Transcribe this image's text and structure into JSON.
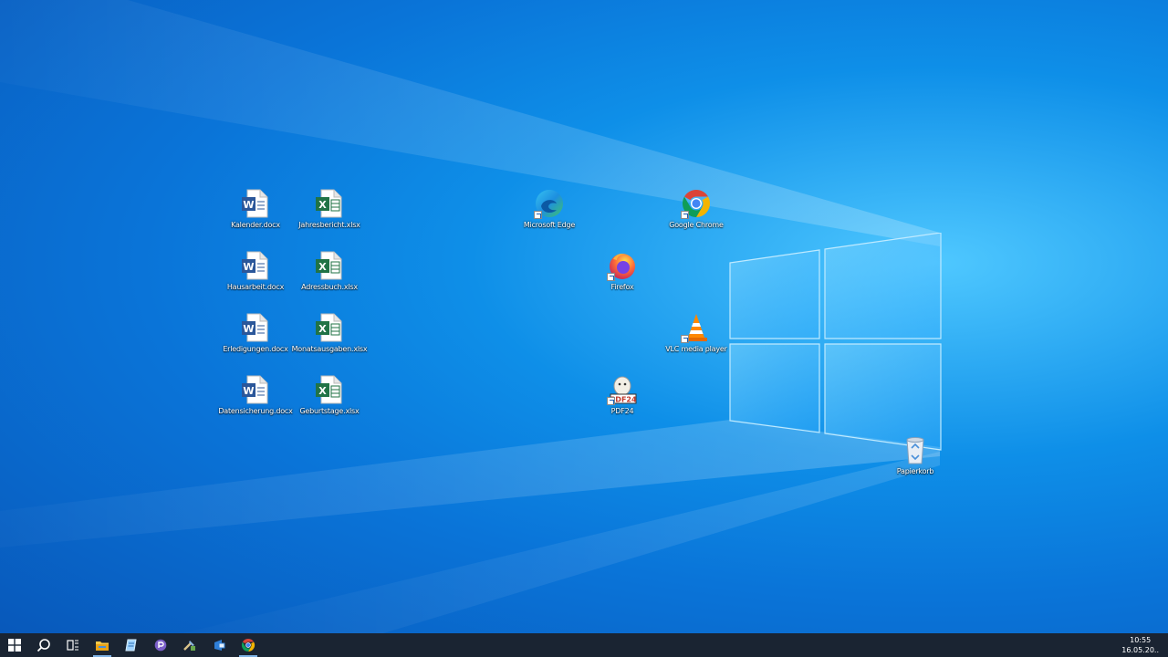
{
  "desktop": {
    "icons": [
      {
        "label": "Kalender.docx",
        "kind": "word"
      },
      {
        "label": "Jahresbericht.xlsx",
        "kind": "excel"
      },
      {
        "label": "Hausarbeit.docx",
        "kind": "word"
      },
      {
        "label": "Adressbuch.xlsx",
        "kind": "excel"
      },
      {
        "label": "Erledigungen.docx",
        "kind": "word"
      },
      {
        "label": "Monatsausgaben.xlsx",
        "kind": "excel"
      },
      {
        "label": "Datensicherung.docx",
        "kind": "word"
      },
      {
        "label": "Geburtstage.xlsx",
        "kind": "excel"
      },
      {
        "label": "Microsoft Edge",
        "kind": "edge-icon"
      },
      {
        "label": "Google Chrome",
        "kind": "chrome-icon"
      },
      {
        "label": "Firefox",
        "kind": "firefox-icon"
      },
      {
        "label": "VLC media player",
        "kind": "vlc-icon"
      },
      {
        "label": "PDF24",
        "kind": "pdf24-icon"
      },
      {
        "label": "Papierkorb",
        "kind": "recycle-bin-icon"
      }
    ]
  },
  "taskbar": {
    "buttons": [
      "start-icon",
      "search-icon",
      "task-view-icon",
      "file-explorer-icon",
      "notepad-icon",
      "pdf-creator-icon",
      "tool-icon",
      "mail-icon",
      "chrome-icon"
    ],
    "clock": {
      "time": "10:55",
      "date": "16.05.20.."
    }
  },
  "colors": {
    "taskbar": "#1a2432",
    "desktop_accent": "#0e8fe8"
  }
}
